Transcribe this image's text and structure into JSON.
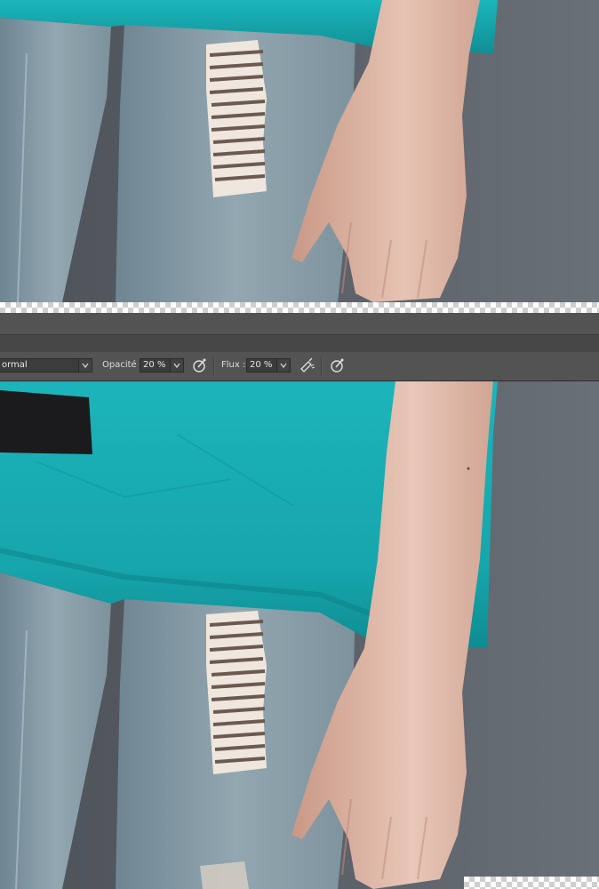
{
  "options_bar": {
    "mode": {
      "value": "ormal",
      "icon": "chevron-down-icon"
    },
    "opacity": {
      "label": "Opacité :",
      "value": "20 %",
      "icon": "chevron-down-icon"
    },
    "pressure_opacity_icon": "pen-pressure-icon",
    "flow": {
      "label": "Flux :",
      "value": "20 %",
      "icon": "chevron-down-icon"
    },
    "airbrush_icon": "airbrush-icon",
    "pressure_size_icon": "pen-pressure-size-icon"
  },
  "colors": {
    "background": "#5a5f66",
    "shirt": "#16a8ad",
    "denim": "#8a9fa9",
    "skin": "#d9b1a0",
    "toolbar": "#535353",
    "field": "#3c3c3c"
  }
}
